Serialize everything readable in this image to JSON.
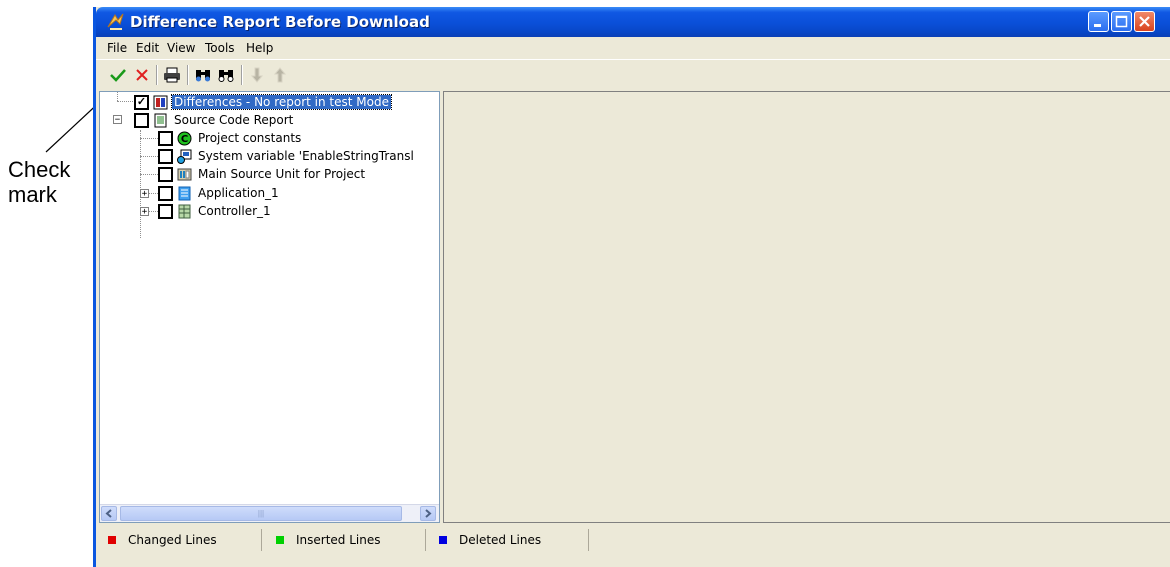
{
  "annotation": {
    "line1": "Check",
    "line2": "mark"
  },
  "window": {
    "title": "Difference Report Before Download"
  },
  "menu": [
    "File",
    "Edit",
    "View",
    "Tools",
    "Help"
  ],
  "toolbar": {
    "icons": [
      "checkmark-icon",
      "x-icon",
      "print-icon",
      "binoculars-icon",
      "find-icon",
      "down-arrow-icon",
      "up-arrow-icon"
    ]
  },
  "tree": {
    "items": [
      {
        "label": "Differences - No report in test Mode",
        "checked": true,
        "icon": "report-book-icon",
        "selected": true
      },
      {
        "label": "Source Code Report",
        "checked": false,
        "icon": "document-icon"
      },
      {
        "label": "Project constants",
        "checked": false,
        "icon": "constants-c-icon"
      },
      {
        "label": "System variable 'EnableStringTransl",
        "checked": false,
        "icon": "system-variable-icon"
      },
      {
        "label": "Main Source Unit for Project",
        "checked": false,
        "icon": "source-unit-icon"
      },
      {
        "label": "Application_1",
        "checked": false,
        "icon": "application-icon"
      },
      {
        "label": "Controller_1",
        "checked": false,
        "icon": "controller-icon"
      }
    ]
  },
  "status": {
    "legend": [
      {
        "label": "Changed Lines",
        "color": "#e00000"
      },
      {
        "label": "Inserted Lines",
        "color": "#00d000"
      },
      {
        "label": "Deleted Lines",
        "color": "#0000e0"
      }
    ]
  }
}
